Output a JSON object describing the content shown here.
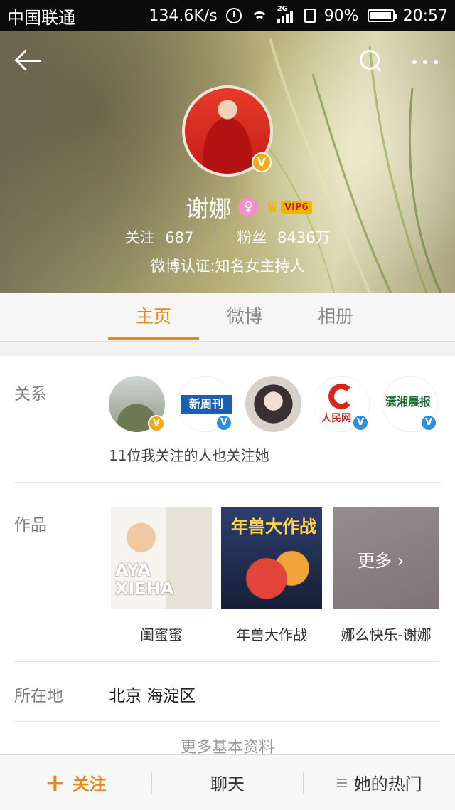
{
  "status_bar": {
    "carrier": "中国联通",
    "speed": "134.6K/s",
    "network": "2G",
    "battery": "90%",
    "time": "20:57"
  },
  "profile": {
    "name": "谢娜",
    "gender_symbol": "♀",
    "vip_level": "VIP6",
    "following_label": "关注",
    "following_count": "687",
    "followers_label": "粉丝",
    "followers_count": "8436万",
    "verification": "微博认证:知名女主持人"
  },
  "tabs": [
    {
      "label": "主页",
      "active": true
    },
    {
      "label": "微博",
      "active": false
    },
    {
      "label": "相册",
      "active": false
    }
  ],
  "relations": {
    "label": "关系",
    "note": "11位我关注的人也关注她",
    "accounts": [
      {
        "logo_text": "",
        "verified": "gold"
      },
      {
        "logo_text": "新周刊",
        "verified": "blue"
      },
      {
        "logo_text": "",
        "verified": "none"
      },
      {
        "logo_text": "人民网",
        "verified": "blue"
      },
      {
        "logo_text": "潇湘晨报",
        "verified": "blue"
      }
    ]
  },
  "works": {
    "label": "作品",
    "items": [
      {
        "title": "闺蜜蜜",
        "cover_text": "AYA XIEHA"
      },
      {
        "title": "年兽大作战",
        "cover_text": "年兽大作战"
      },
      {
        "title": "娜么快乐-谢娜",
        "cover_text": "更多 ›"
      }
    ]
  },
  "location": {
    "label": "所在地",
    "value": "北京 海淀区"
  },
  "more_info": "更多基本资料",
  "bottom_bar": {
    "follow": "关注",
    "chat": "聊天",
    "hot": "她的热门"
  },
  "colors": {
    "accent": "#e9871c",
    "verified_gold": "#f3a91b",
    "verified_blue": "#2f8ee0"
  }
}
